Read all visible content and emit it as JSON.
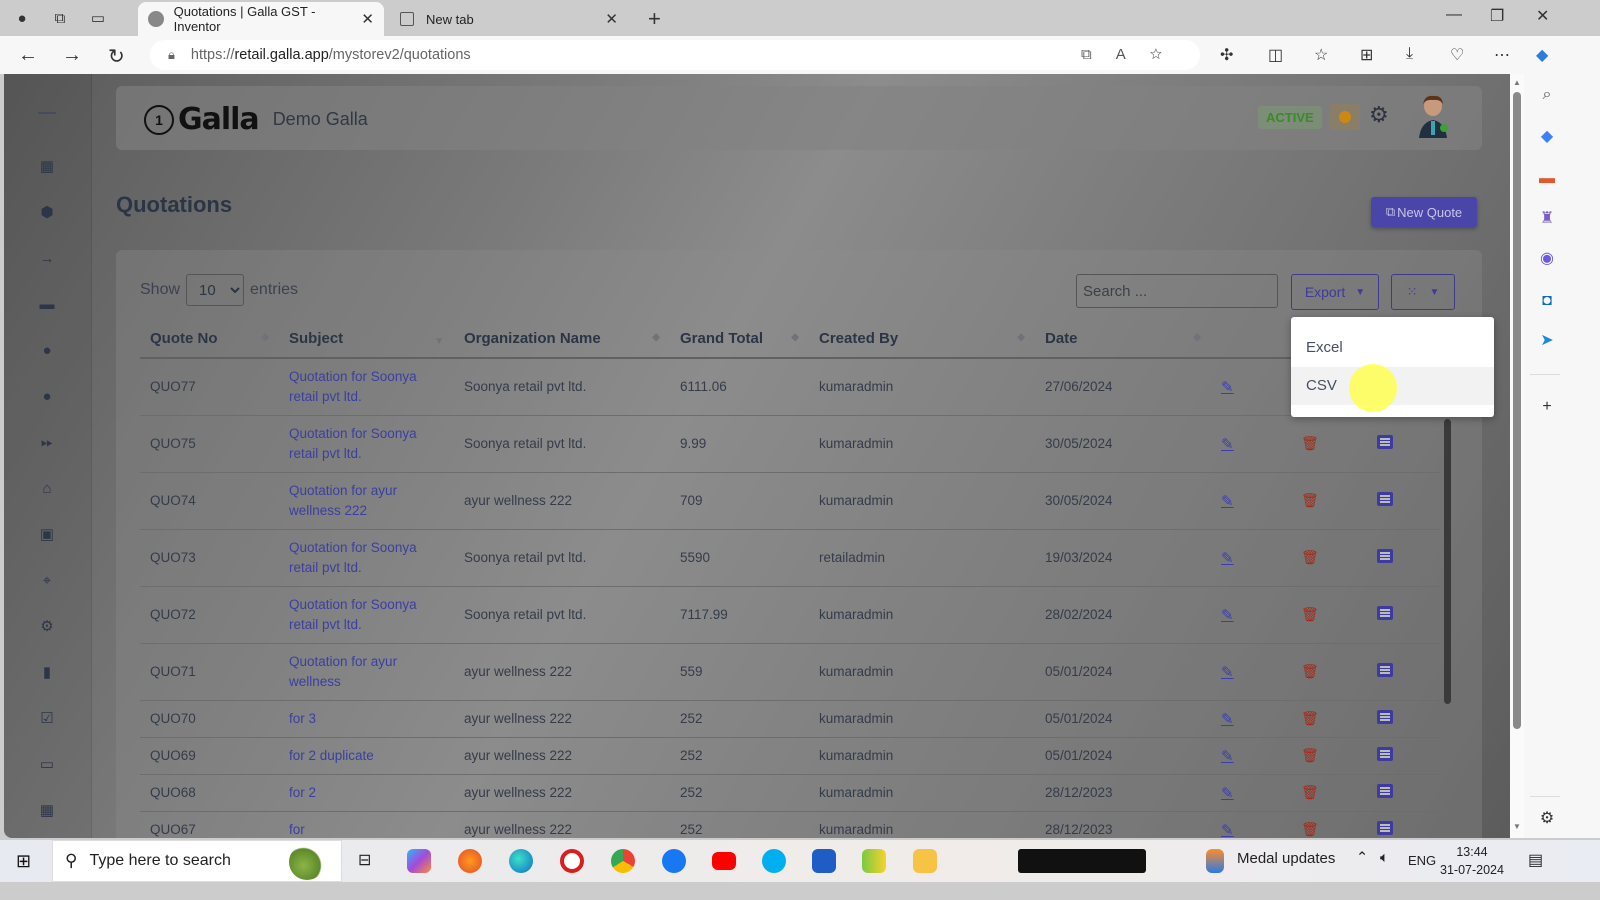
{
  "browser": {
    "tabs": [
      {
        "label": "Quotations | Galla GST - Inventor",
        "active": true
      },
      {
        "label": "New tab",
        "active": false
      }
    ],
    "url_prefix": "https://",
    "url_domain": "retail.galla.app",
    "url_path": "/mystorev2/quotations"
  },
  "app": {
    "brand": "Galla",
    "store_name": "Demo Galla",
    "status_badge": "ACTIVE",
    "page_title": "Quotations",
    "new_quote_label": "New Quote",
    "accent_color": "#4a45a8"
  },
  "table_controls": {
    "show_label": "Show",
    "entries_label": "entries",
    "page_size": "10",
    "search_placeholder": "Search ...",
    "export_label": "Export",
    "export_options": [
      "Excel",
      "CSV"
    ],
    "hovered_option": "CSV"
  },
  "table": {
    "columns": [
      "Quote No",
      "Subject",
      "Organization Name",
      "Grand Total",
      "Created By",
      "Date"
    ],
    "rows": [
      {
        "quote_no": "QUO77",
        "subject": "Quotation for Soonya retail pvt ltd.",
        "org": "Soonya retail pvt ltd.",
        "total": "6111.06",
        "created_by": "kumaradmin",
        "date": "27/06/2024"
      },
      {
        "quote_no": "QUO75",
        "subject": "Quotation for Soonya retail pvt ltd.",
        "org": "Soonya retail pvt ltd.",
        "total": "9.99",
        "created_by": "kumaradmin",
        "date": "30/05/2024"
      },
      {
        "quote_no": "QUO74",
        "subject": "Quotation for ayur wellness 222",
        "org": "ayur wellness 222",
        "total": "709",
        "created_by": "kumaradmin",
        "date": "30/05/2024"
      },
      {
        "quote_no": "QUO73",
        "subject": "Quotation for Soonya retail pvt ltd.",
        "org": "Soonya retail pvt ltd.",
        "total": "5590",
        "created_by": "retailadmin",
        "date": "19/03/2024"
      },
      {
        "quote_no": "QUO72",
        "subject": "Quotation for Soonya retail pvt ltd.",
        "org": "Soonya retail pvt ltd.",
        "total": "7117.99",
        "created_by": "kumaradmin",
        "date": "28/02/2024"
      },
      {
        "quote_no": "QUO71",
        "subject": "Quotation for ayur wellness",
        "org": "ayur wellness 222",
        "total": "559",
        "created_by": "kumaradmin",
        "date": "05/01/2024"
      },
      {
        "quote_no": "QUO70",
        "subject": "for 3",
        "org": "ayur wellness 222",
        "total": "252",
        "created_by": "kumaradmin",
        "date": "05/01/2024"
      },
      {
        "quote_no": "QUO69",
        "subject": "for 2 duplicate",
        "org": "ayur wellness 222",
        "total": "252",
        "created_by": "kumaradmin",
        "date": "05/01/2024"
      },
      {
        "quote_no": "QUO68",
        "subject": "for 2",
        "org": "ayur wellness 222",
        "total": "252",
        "created_by": "kumaradmin",
        "date": "28/12/2023"
      },
      {
        "quote_no": "QUO67",
        "subject": "for",
        "org": "ayur wellness 222",
        "total": "252",
        "created_by": "kumaradmin",
        "date": "28/12/2023"
      }
    ]
  },
  "sidebar": {
    "icons": [
      "dashboard-icon",
      "box-icon",
      "arrow-right-icon",
      "coupon-icon",
      "user-icon",
      "user-circle-icon",
      "fast-forward-icon",
      "basket-icon",
      "contacts-icon",
      "location-icon",
      "settings-icon",
      "report-icon",
      "checkbox-icon",
      "cash-icon",
      "calendar-icon"
    ]
  },
  "taskbar": {
    "search_placeholder": "Type here to search",
    "news_label": "Medal updates",
    "language": "ENG",
    "time": "13:44",
    "date": "31-07-2024"
  }
}
